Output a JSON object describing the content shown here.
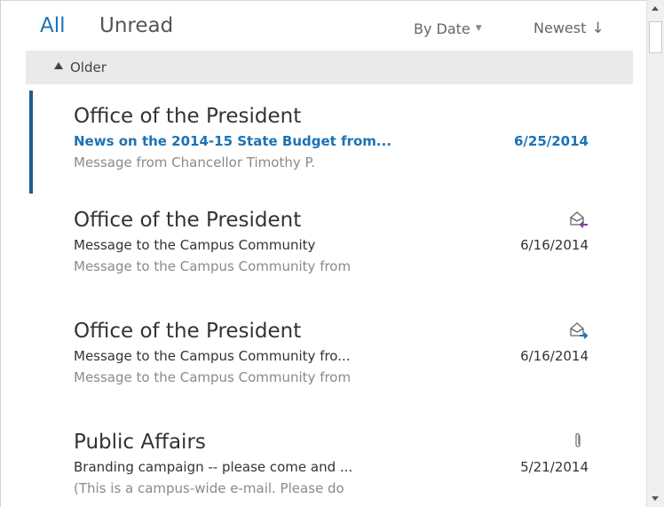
{
  "filter": {
    "all_label": "All",
    "unread_label": "Unread",
    "sort_by_label": "By Date",
    "sort_order_label": "Newest",
    "sort_order_arrow": "↓",
    "sort_by_caret": "▼"
  },
  "group": {
    "label": "Older"
  },
  "messages": [
    {
      "sender": "Office of the President",
      "subject": "News on the 2014-15 State Budget from...",
      "preview": "Message from Chancellor Timothy P.",
      "date": "6/25/2014",
      "unread": true,
      "selected": true,
      "icon": "none"
    },
    {
      "sender": "Office of the President",
      "subject": "Message to the Campus Community",
      "preview": "Message to the Campus Community from",
      "date": "6/16/2014",
      "unread": false,
      "selected": false,
      "icon": "envelope-replied-icon"
    },
    {
      "sender": "Office of the President",
      "subject": "Message to the Campus Community fro...",
      "preview": "Message to the Campus Community from",
      "date": "6/16/2014",
      "unread": false,
      "selected": false,
      "icon": "envelope-forwarded-icon"
    },
    {
      "sender": "Public Affairs",
      "subject": "Branding campaign -- please come and ...",
      "preview": "(This is a campus-wide e-mail. Please do",
      "date": "5/21/2014",
      "unread": false,
      "selected": false,
      "icon": "paperclip-icon"
    }
  ],
  "colors": {
    "accent": "#1c73b5",
    "selection_bar": "#195f8c",
    "group_header_bg": "#eaeaea",
    "reply_arrow": "#7a3fa0",
    "forward_arrow": "#1c73b5"
  }
}
